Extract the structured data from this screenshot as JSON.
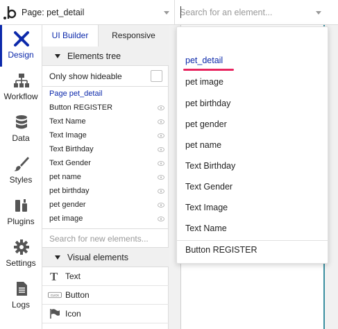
{
  "topbar": {
    "logo_glyph": ".b",
    "page_selector_label": "Page: pet_detail",
    "element_search_placeholder": "Search for an element..."
  },
  "leftnav": {
    "items": [
      {
        "label": "Design",
        "icon": "design-icon",
        "active": true
      },
      {
        "label": "Workflow",
        "icon": "workflow-icon"
      },
      {
        "label": "Data",
        "icon": "database-icon"
      },
      {
        "label": "Styles",
        "icon": "brush-icon"
      },
      {
        "label": "Plugins",
        "icon": "plugin-icon"
      },
      {
        "label": "Settings",
        "icon": "gear-icon"
      },
      {
        "label": "Logs",
        "icon": "document-icon"
      }
    ],
    "accent_color": "#0c29ab"
  },
  "panel": {
    "tabs": [
      {
        "label": "UI Builder",
        "active": true
      },
      {
        "label": "Responsive",
        "active": false
      }
    ],
    "elements_tree_title": "Elements tree",
    "only_show_hideable_label": "Only show hideable",
    "tree": [
      "Page pet_detail",
      "Button REGISTER",
      "Text Name",
      "Text Image",
      "Text Birthday",
      "Text Gender",
      "pet name",
      "pet birthday",
      "pet gender",
      "pet image"
    ],
    "search_new_placeholder": "Search for new elements...",
    "visual_elements_title": "Visual elements",
    "visual_elements": [
      {
        "label": "Text",
        "icon": "text-icon"
      },
      {
        "label": "Button",
        "icon": "button-icon",
        "icon_text": "CLICK"
      },
      {
        "label": "Icon",
        "icon": "flag-icon"
      }
    ]
  },
  "dropdown": {
    "items": [
      {
        "label": "pet_detail",
        "selected": true
      },
      {
        "label": "pet image"
      },
      {
        "label": "pet birthday"
      },
      {
        "label": "pet gender"
      },
      {
        "label": "pet name"
      },
      {
        "label": "Text Birthday"
      },
      {
        "label": "Text Gender"
      },
      {
        "label": "Text Image"
      },
      {
        "label": "Text Name"
      },
      {
        "label": "Button REGISTER"
      }
    ],
    "highlight_color": "#e8245f"
  }
}
